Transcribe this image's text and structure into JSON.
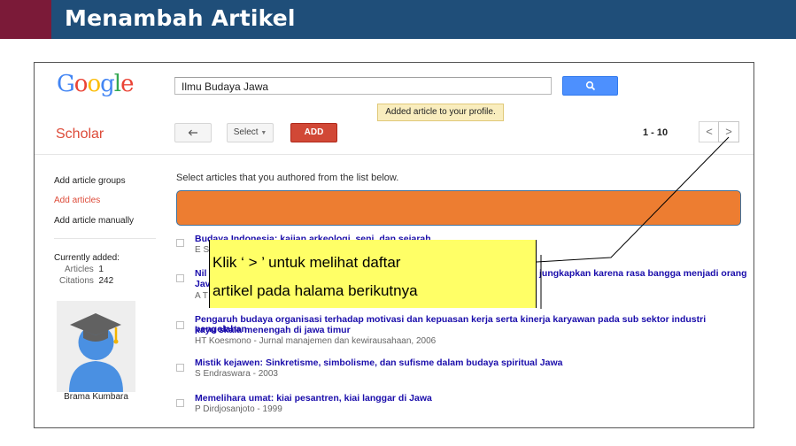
{
  "slide": {
    "title": "Menambah Artikel"
  },
  "logo": {
    "letters": [
      "G",
      "o",
      "o",
      "g",
      "l",
      "e"
    ],
    "colors": [
      "#4285f4",
      "#ea4335",
      "#fbbc05",
      "#4285f4",
      "#34a853",
      "#ea4335"
    ]
  },
  "search": {
    "value": "Ilmu Budaya Jawa"
  },
  "toast": "Added article to your profile.",
  "scholar_label": "Scholar",
  "toolbar": {
    "select_label": "Select",
    "add_label": "ADD"
  },
  "pager": {
    "range": "1 - 10",
    "prev": "<",
    "next": ">"
  },
  "sidebar": {
    "items": [
      "Add article groups",
      "Add articles",
      "Add article manually"
    ],
    "currently_added_label": "Currently added:",
    "articles_label": "Articles",
    "articles_count": "1",
    "citations_label": "Citations",
    "citations_count": "242",
    "user_name": "Brama Kumbara"
  },
  "main": {
    "intro": "Select articles that you authored from the list below."
  },
  "results": [
    {
      "title": "Budaya Indonesia: kajian arkeologi, seni, dan sejarah",
      "meta": "E S"
    },
    {
      "title_start": "Nil",
      "title_end": "jungkapkan karena rasa bangga menjadi orang",
      "title_line2": "Jav",
      "meta": "A T"
    },
    {
      "title_line1": "Pengaruh budaya organisasi terhadap motivasi dan kepuasan kerja serta kinerja karyawan pada sub sektor industri pengolahan",
      "title_line2": "kayu skala menengah di jawa timur",
      "meta": "HT Koesmono - Jurnal manajemen dan kewirausahaan, 2006"
    },
    {
      "title": "Mistik kejawen: Sinkretisme, simbolisme, dan sufisme dalam budaya spiritual Jawa",
      "meta": "S Endraswara - 2003"
    },
    {
      "title": "Memelihara umat: kiai pesantren, kiai langgar di Jawa",
      "meta": "P Dirdjosanjoto - 1999"
    }
  ],
  "callout": {
    "line1": "Klik ‘ > ’ untuk melihat daftar",
    "line2": "artikel pada halama berikutnya"
  }
}
